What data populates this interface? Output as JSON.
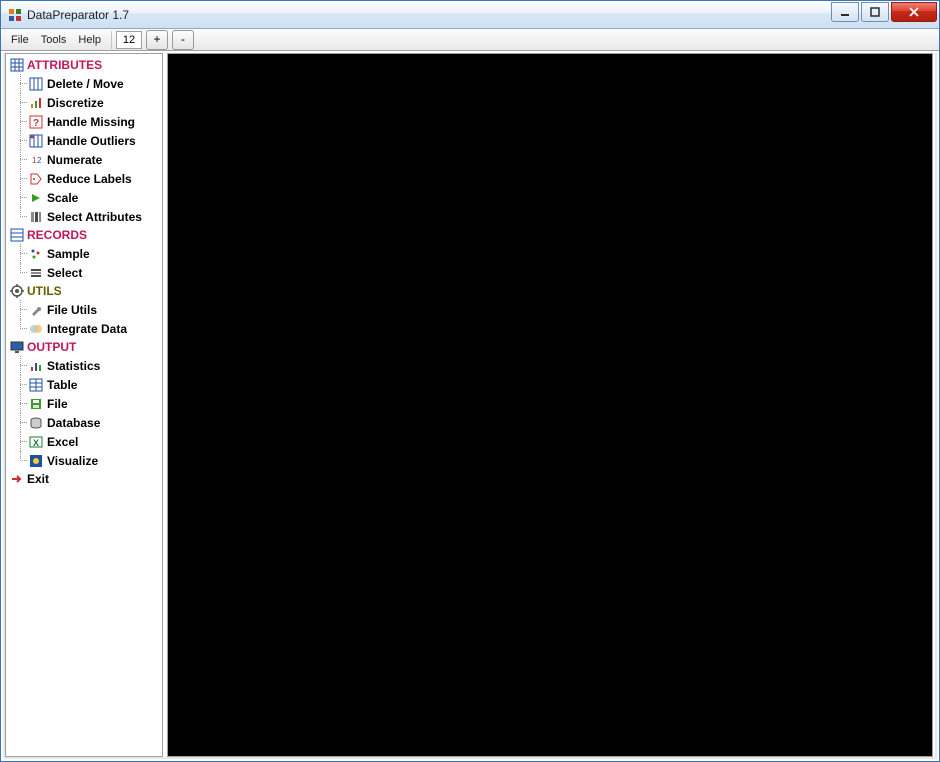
{
  "window": {
    "title": "DataPreparator 1.7"
  },
  "menubar": {
    "file": "File",
    "tools": "Tools",
    "help": "Help"
  },
  "toolbar": {
    "zoom_value": "12",
    "plus_label": "+",
    "minus_label": "-"
  },
  "tree": {
    "attributes": {
      "label": "ATTRIBUTES",
      "items": [
        {
          "label": "Delete / Move",
          "icon": "grid-icon"
        },
        {
          "label": "Discretize",
          "icon": "chart-discretize-icon"
        },
        {
          "label": "Handle Missing",
          "icon": "question-icon"
        },
        {
          "label": "Handle Outliers",
          "icon": "grid-icon"
        },
        {
          "label": "Numerate",
          "icon": "numerate-icon"
        },
        {
          "label": "Reduce Labels",
          "icon": "tag-icon"
        },
        {
          "label": "Scale",
          "icon": "play-icon"
        },
        {
          "label": "Select Attributes",
          "icon": "columns-icon"
        }
      ]
    },
    "records": {
      "label": "RECORDS",
      "items": [
        {
          "label": "Sample",
          "icon": "sample-icon"
        },
        {
          "label": "Select",
          "icon": "rows-icon"
        }
      ]
    },
    "utils": {
      "label": "UTILS",
      "items": [
        {
          "label": "File Utils",
          "icon": "wrench-icon"
        },
        {
          "label": "Integrate Data",
          "icon": "merge-icon"
        }
      ]
    },
    "output": {
      "label": "OUTPUT",
      "items": [
        {
          "label": "Statistics",
          "icon": "bar-chart-icon"
        },
        {
          "label": "Table",
          "icon": "table-icon"
        },
        {
          "label": "File",
          "icon": "disk-icon"
        },
        {
          "label": "Database",
          "icon": "database-icon"
        },
        {
          "label": "Excel",
          "icon": "excel-icon"
        },
        {
          "label": "Visualize",
          "icon": "visualize-icon"
        }
      ]
    },
    "exit": {
      "label": "Exit"
    }
  }
}
